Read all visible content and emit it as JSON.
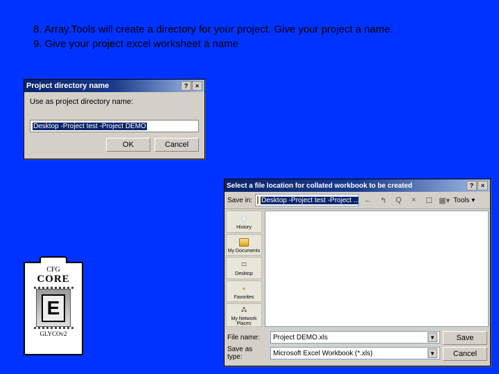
{
  "instructions": {
    "line1": "8. Array.Tools will create a directory for your project. Give your project a name.",
    "line2": "9. Give your project excel worksheet a name"
  },
  "dialog1": {
    "title": "Project directory name",
    "prompt": "Use as project directory name:",
    "input_value": "Desktop -Project test -Project DEMO",
    "ok": "OK",
    "cancel": "Cancel",
    "help_btn": "?",
    "close_btn": "×"
  },
  "dialog2": {
    "title": "Select a file location for collated workbook to be created",
    "help_btn": "?",
    "close_btn": "×",
    "savein_label": "Save in:",
    "savein_value": "Desktop -Project test -Project ...",
    "tools_label": "Tools ▾",
    "toolbar_icons": {
      "back": "←",
      "up": "↰",
      "search": "Q",
      "delete": "×",
      "new": "☐",
      "views": "▦▾"
    },
    "places": {
      "history": "History",
      "docs": "My Documents",
      "desktop": "Desktop",
      "favorites": "Favorites",
      "network": "My Network Places"
    },
    "place_glyphs": {
      "history": "🕘",
      "docs_folder": "folder",
      "desktop": "🖵",
      "favorites": "★",
      "network": "🖧"
    },
    "filename_label": "File name:",
    "filename_value": "Project DEMO.xls",
    "saveastype_label": "Save as type:",
    "saveastype_value": "Microsoft Excel Workbook (*.xls)",
    "save_btn": "Save",
    "cancel_btn": "Cancel"
  },
  "logo": {
    "top": "CFG",
    "mid": "CORE",
    "chip": "E",
    "bottom": "GLYCOv2"
  }
}
